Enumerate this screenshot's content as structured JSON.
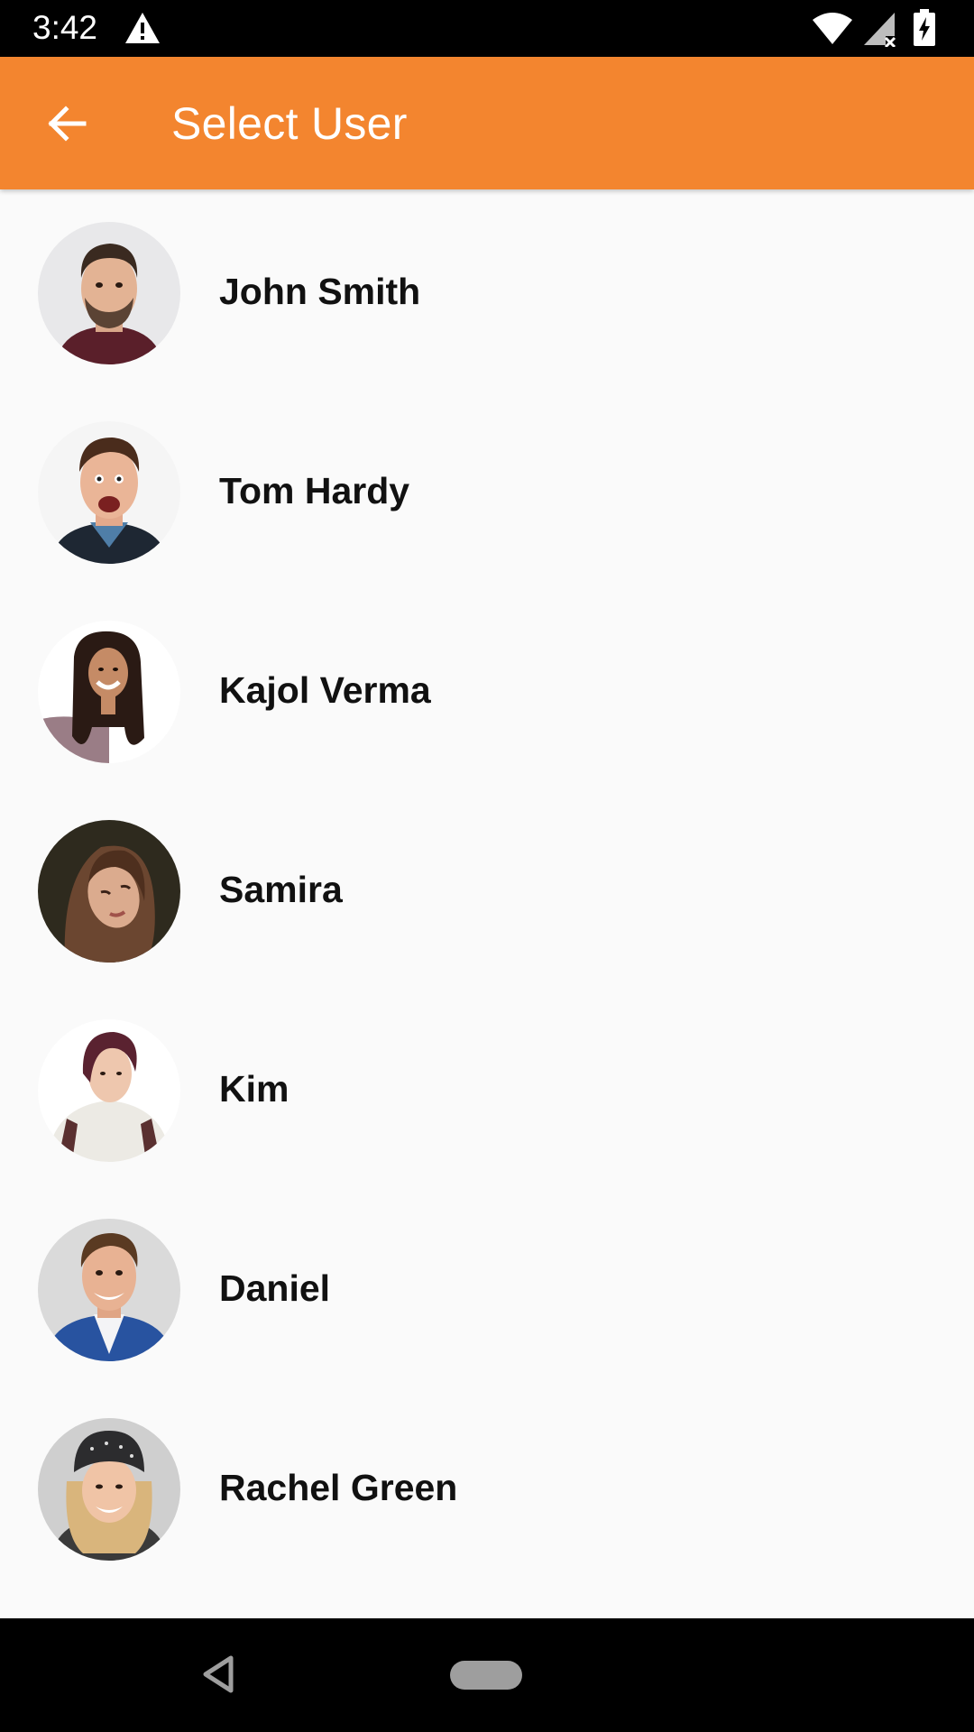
{
  "status_bar": {
    "time": "3:42",
    "icons": [
      "warning-icon",
      "wifi-icon",
      "signal-no-data-icon",
      "battery-charging-icon"
    ]
  },
  "app_bar": {
    "title": "Select User",
    "back_icon": "arrow-back-icon",
    "background_color": "#f3852f"
  },
  "users": [
    {
      "name": "John Smith",
      "avatar": "photo of a man with beard and dark hair"
    },
    {
      "name": "Tom Hardy",
      "avatar": "photo of an excited man in denim shirt"
    },
    {
      "name": "Kajol Verma",
      "avatar": "photo of a smiling woman with long curly hair"
    },
    {
      "name": "Samira",
      "avatar": "photo of a woman with long brown hair"
    },
    {
      "name": "Kim",
      "avatar": "photo of a young person in a white hoodie"
    },
    {
      "name": "Daniel",
      "avatar": "photo of a smiling man in blue suit"
    },
    {
      "name": "Rachel Green",
      "avatar": "photo of a smiling woman in a beanie hat"
    }
  ],
  "nav_bar": {
    "icons": [
      "nav-back-icon",
      "nav-home-icon"
    ]
  }
}
